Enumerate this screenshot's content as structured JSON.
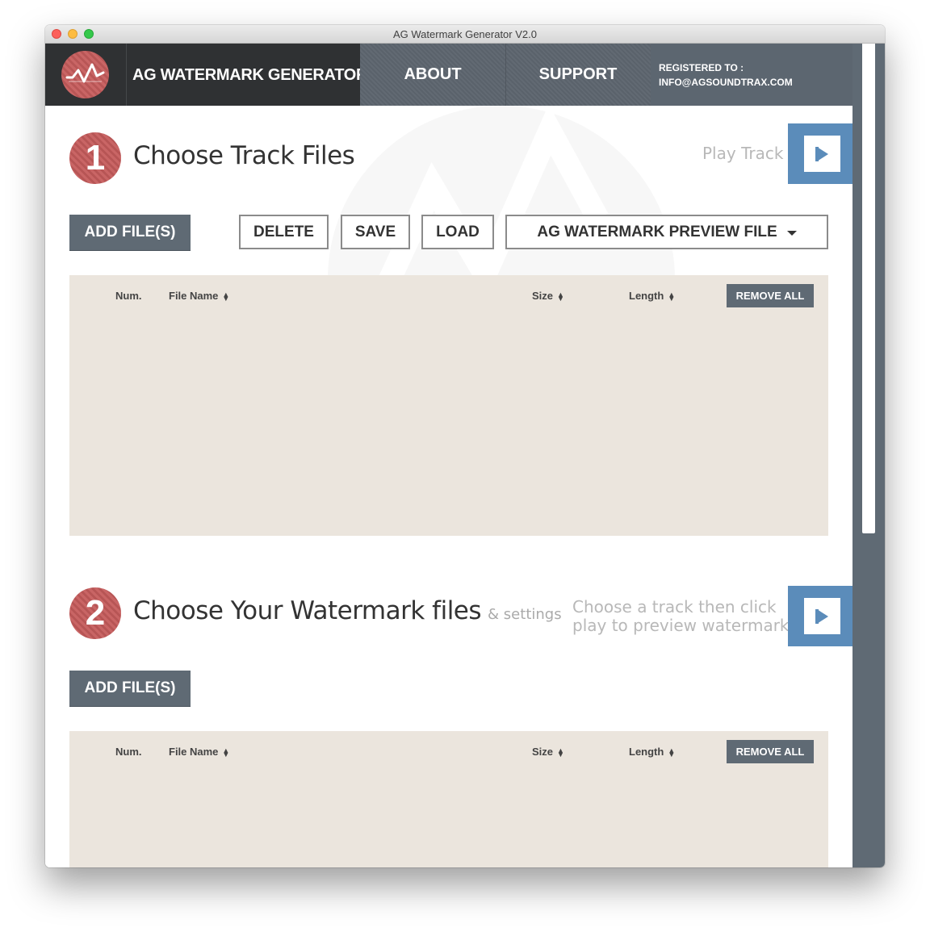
{
  "window": {
    "title": "AG Watermark Generator V2.0"
  },
  "header": {
    "app_name": "AG WATERMARK GENERATOR",
    "nav": {
      "about": "ABOUT",
      "support": "SUPPORT"
    },
    "registered_label": "REGISTERED TO :",
    "registered_email": "INFO@AGSOUNDTRAX.COM"
  },
  "step1": {
    "number": "1",
    "title": "Choose Track Files",
    "play_label": "Play Track",
    "add_files": "ADD FILE(S)",
    "delete": "DELETE",
    "save": "SAVE",
    "load": "LOAD",
    "preset_select": "AG WATERMARK PREVIEW FILE",
    "table": {
      "columns": {
        "num": "Num.",
        "file_name": "File Name",
        "size": "Size",
        "length": "Length"
      },
      "remove_all": "REMOVE ALL",
      "rows": []
    }
  },
  "step2": {
    "number": "2",
    "title": "Choose Your Watermark files",
    "subtitle": "& settings",
    "hint_line1": "Choose a track then click",
    "hint_line2": "play to preview watermark",
    "add_files": "ADD FILE(S)",
    "table": {
      "columns": {
        "num": "Num.",
        "file_name": "File Name",
        "size": "Size",
        "length": "Length"
      },
      "remove_all": "REMOVE ALL",
      "rows": []
    }
  },
  "colors": {
    "header_dark": "#2f3133",
    "nav_gray": "#5f6a74",
    "accent_red": "#c96565",
    "play_blue": "#5b8cba",
    "table_beige": "#ebe5dd"
  }
}
